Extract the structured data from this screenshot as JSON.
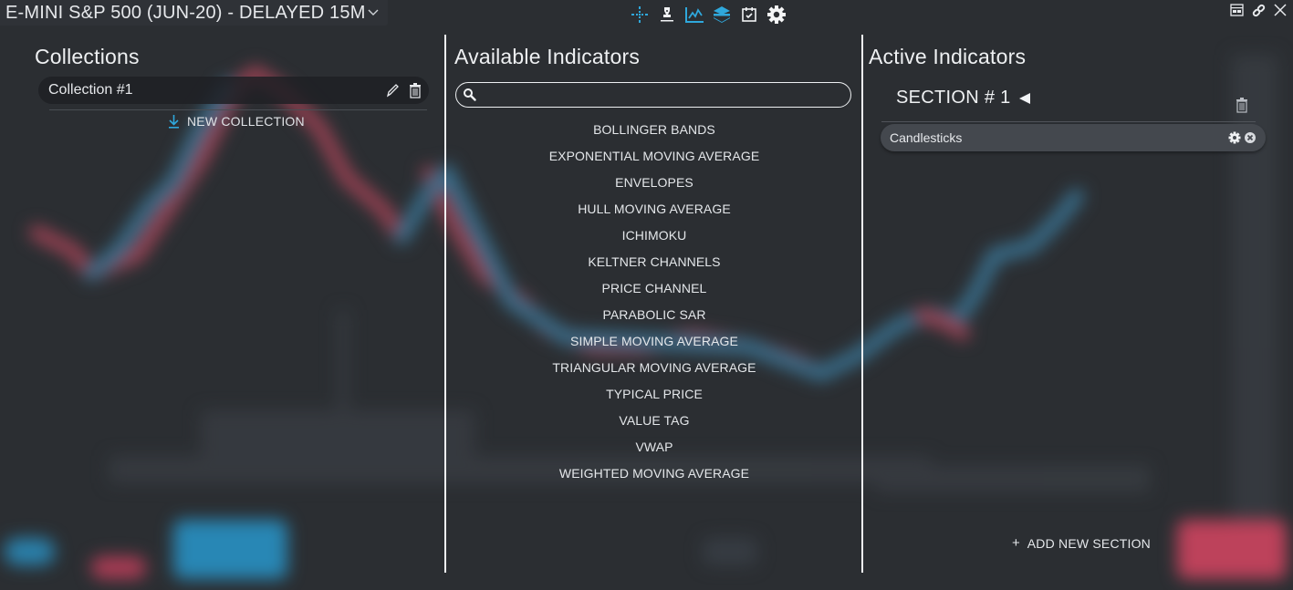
{
  "window": {
    "symbol_title": "E-MINI S&P 500 (JUN-20) - DELAYED 15M",
    "symbol_dropdown_icon": "chevron-down-icon",
    "toolbar_icons": [
      "crosshair-icon",
      "drawing-pen-icon",
      "line-chart-icon",
      "layers-icon",
      "calendar-check-icon",
      "gear-icon"
    ],
    "window_controls": [
      "layout-icon",
      "link-icon",
      "close-icon"
    ],
    "accent_color": "#2fa8dc"
  },
  "collections": {
    "title": "Collections",
    "items": [
      {
        "name": "Collection #1"
      }
    ],
    "new_collection_label": "NEW COLLECTION"
  },
  "available": {
    "title": "Available Indicators",
    "search": {
      "value": "",
      "placeholder": ""
    },
    "indicators": [
      "BOLLINGER BANDS",
      "EXPONENTIAL MOVING AVERAGE",
      "ENVELOPES",
      "HULL MOVING AVERAGE",
      "ICHIMOKU",
      "KELTNER CHANNELS",
      "PRICE CHANNEL",
      "PARABOLIC SAR",
      "SIMPLE MOVING AVERAGE",
      "TRIANGULAR MOVING AVERAGE",
      "TYPICAL PRICE",
      "VALUE TAG",
      "VWAP",
      "WEIGHTED MOVING AVERAGE"
    ]
  },
  "active": {
    "title": "Active Indicators",
    "sections": [
      {
        "label": "SECTION # 1",
        "indicators": [
          {
            "name": "Candlesticks"
          }
        ]
      }
    ],
    "add_section_label": "ADD NEW SECTION",
    "add_section_symbol": "+"
  }
}
